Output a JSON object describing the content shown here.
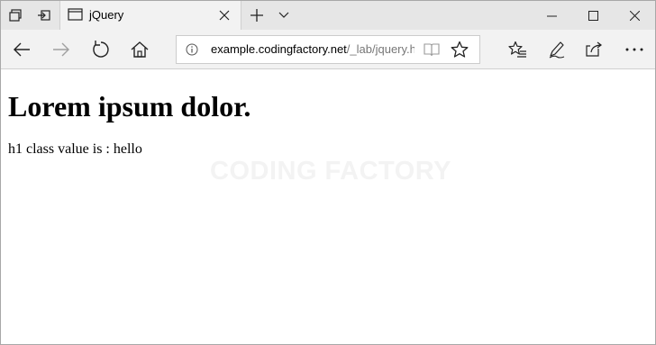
{
  "browser": {
    "tab": {
      "title": "jQuery"
    },
    "address_bar": {
      "host": "example.codingfactory.net",
      "path": "/_lab/jquery.ht"
    },
    "icons": {
      "tab_actions": [
        "tabs-aside-icon",
        "set-aside-tabs-icon"
      ],
      "tab": [
        "page-icon",
        "close-icon"
      ],
      "new_tab": [
        "plus-icon",
        "chevron-down-icon"
      ],
      "window": [
        "minimize-icon",
        "maximize-icon",
        "close-window-icon"
      ],
      "nav": [
        "back-arrow-icon",
        "forward-arrow-icon",
        "refresh-icon",
        "home-icon"
      ],
      "address": [
        "info-icon",
        "reading-view-icon",
        "star-icon"
      ],
      "toolbar": [
        "favorites-hub-icon",
        "pen-icon",
        "share-icon",
        "more-icon"
      ]
    },
    "colors": {
      "titlebar": "#e6e6e6",
      "tab_active": "#f2f2f2",
      "navbar": "#f2f2f2",
      "path_text": "#777777"
    }
  },
  "page": {
    "heading": "Lorem ipsum dolor.",
    "text": "h1 class value is : hello",
    "watermark": "CODING FACTORY"
  }
}
